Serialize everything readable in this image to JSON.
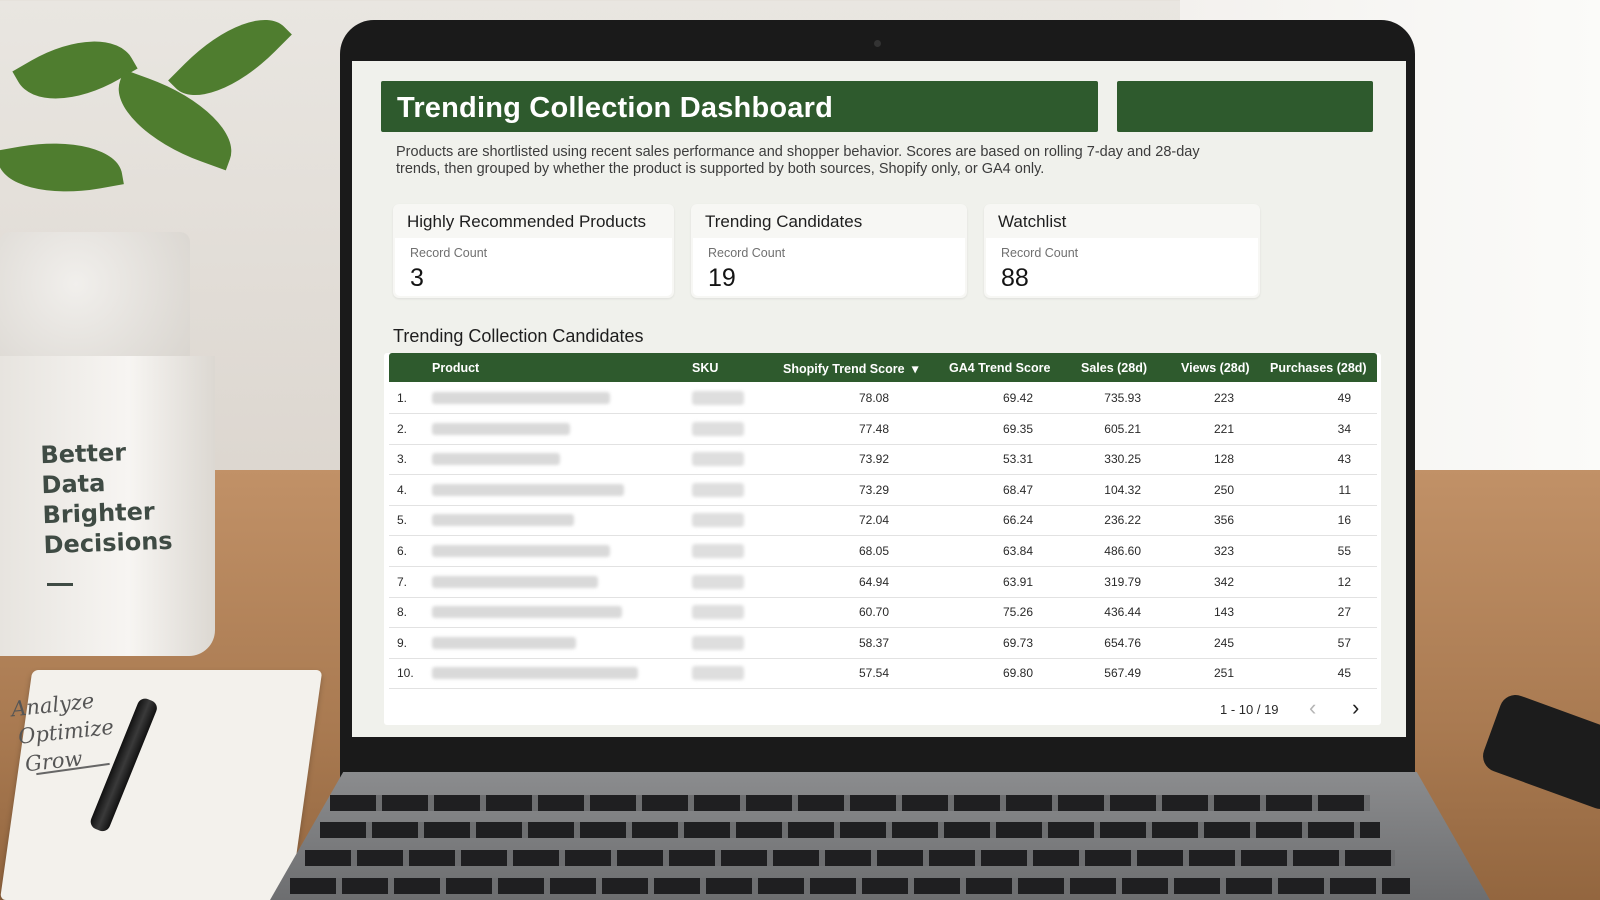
{
  "dashboard": {
    "title": "Trending Collection Dashboard",
    "description": "Products are shortlisted using recent sales performance and shopper behavior. Scores are based on rolling 7-day and 28-day trends, then grouped by whether the product is supported by both sources, Shopify only, or GA4 only."
  },
  "cards": [
    {
      "title": "Highly Recommended Products",
      "label": "Record Count",
      "value": "3"
    },
    {
      "title": "Trending Candidates",
      "label": "Record Count",
      "value": "19"
    },
    {
      "title": "Watchlist",
      "label": "Record Count",
      "value": "88"
    }
  ],
  "table": {
    "title": "Trending Collection Candidates",
    "columns": [
      "Product",
      "SKU",
      "Shopify Trend Score",
      "GA4 Trend Score",
      "Sales (28d)",
      "Views (28d)",
      "Purchases (28d)"
    ],
    "sort_indicator": "▾",
    "rows": [
      {
        "n": "1.",
        "shopify": "78.08",
        "ga4": "69.42",
        "sales": "735.93",
        "views": "223",
        "purchases": "49"
      },
      {
        "n": "2.",
        "shopify": "77.48",
        "ga4": "69.35",
        "sales": "605.21",
        "views": "221",
        "purchases": "34"
      },
      {
        "n": "3.",
        "shopify": "73.92",
        "ga4": "53.31",
        "sales": "330.25",
        "views": "128",
        "purchases": "43"
      },
      {
        "n": "4.",
        "shopify": "73.29",
        "ga4": "68.47",
        "sales": "104.32",
        "views": "250",
        "purchases": "11"
      },
      {
        "n": "5.",
        "shopify": "72.04",
        "ga4": "66.24",
        "sales": "236.22",
        "views": "356",
        "purchases": "16"
      },
      {
        "n": "6.",
        "shopify": "68.05",
        "ga4": "63.84",
        "sales": "486.60",
        "views": "323",
        "purchases": "55"
      },
      {
        "n": "7.",
        "shopify": "64.94",
        "ga4": "63.91",
        "sales": "319.79",
        "views": "342",
        "purchases": "12"
      },
      {
        "n": "8.",
        "shopify": "60.70",
        "ga4": "75.26",
        "sales": "436.44",
        "views": "143",
        "purchases": "27"
      },
      {
        "n": "9.",
        "shopify": "58.37",
        "ga4": "69.73",
        "sales": "654.76",
        "views": "245",
        "purchases": "57"
      },
      {
        "n": "10.",
        "shopify": "57.54",
        "ga4": "69.80",
        "sales": "567.49",
        "views": "251",
        "purchases": "45"
      }
    ],
    "pagination": {
      "range": "1 - 10 / 19",
      "prev": "‹",
      "next": "›"
    }
  },
  "scene": {
    "mug_lines": [
      "Better",
      "Data",
      "Brighter",
      "Decisions"
    ],
    "note_lines": [
      "Analyze",
      "Optimize",
      "Grow"
    ]
  },
  "colors": {
    "header_green": "#2e5a2d",
    "screen_bg": "#f0f1ec"
  }
}
